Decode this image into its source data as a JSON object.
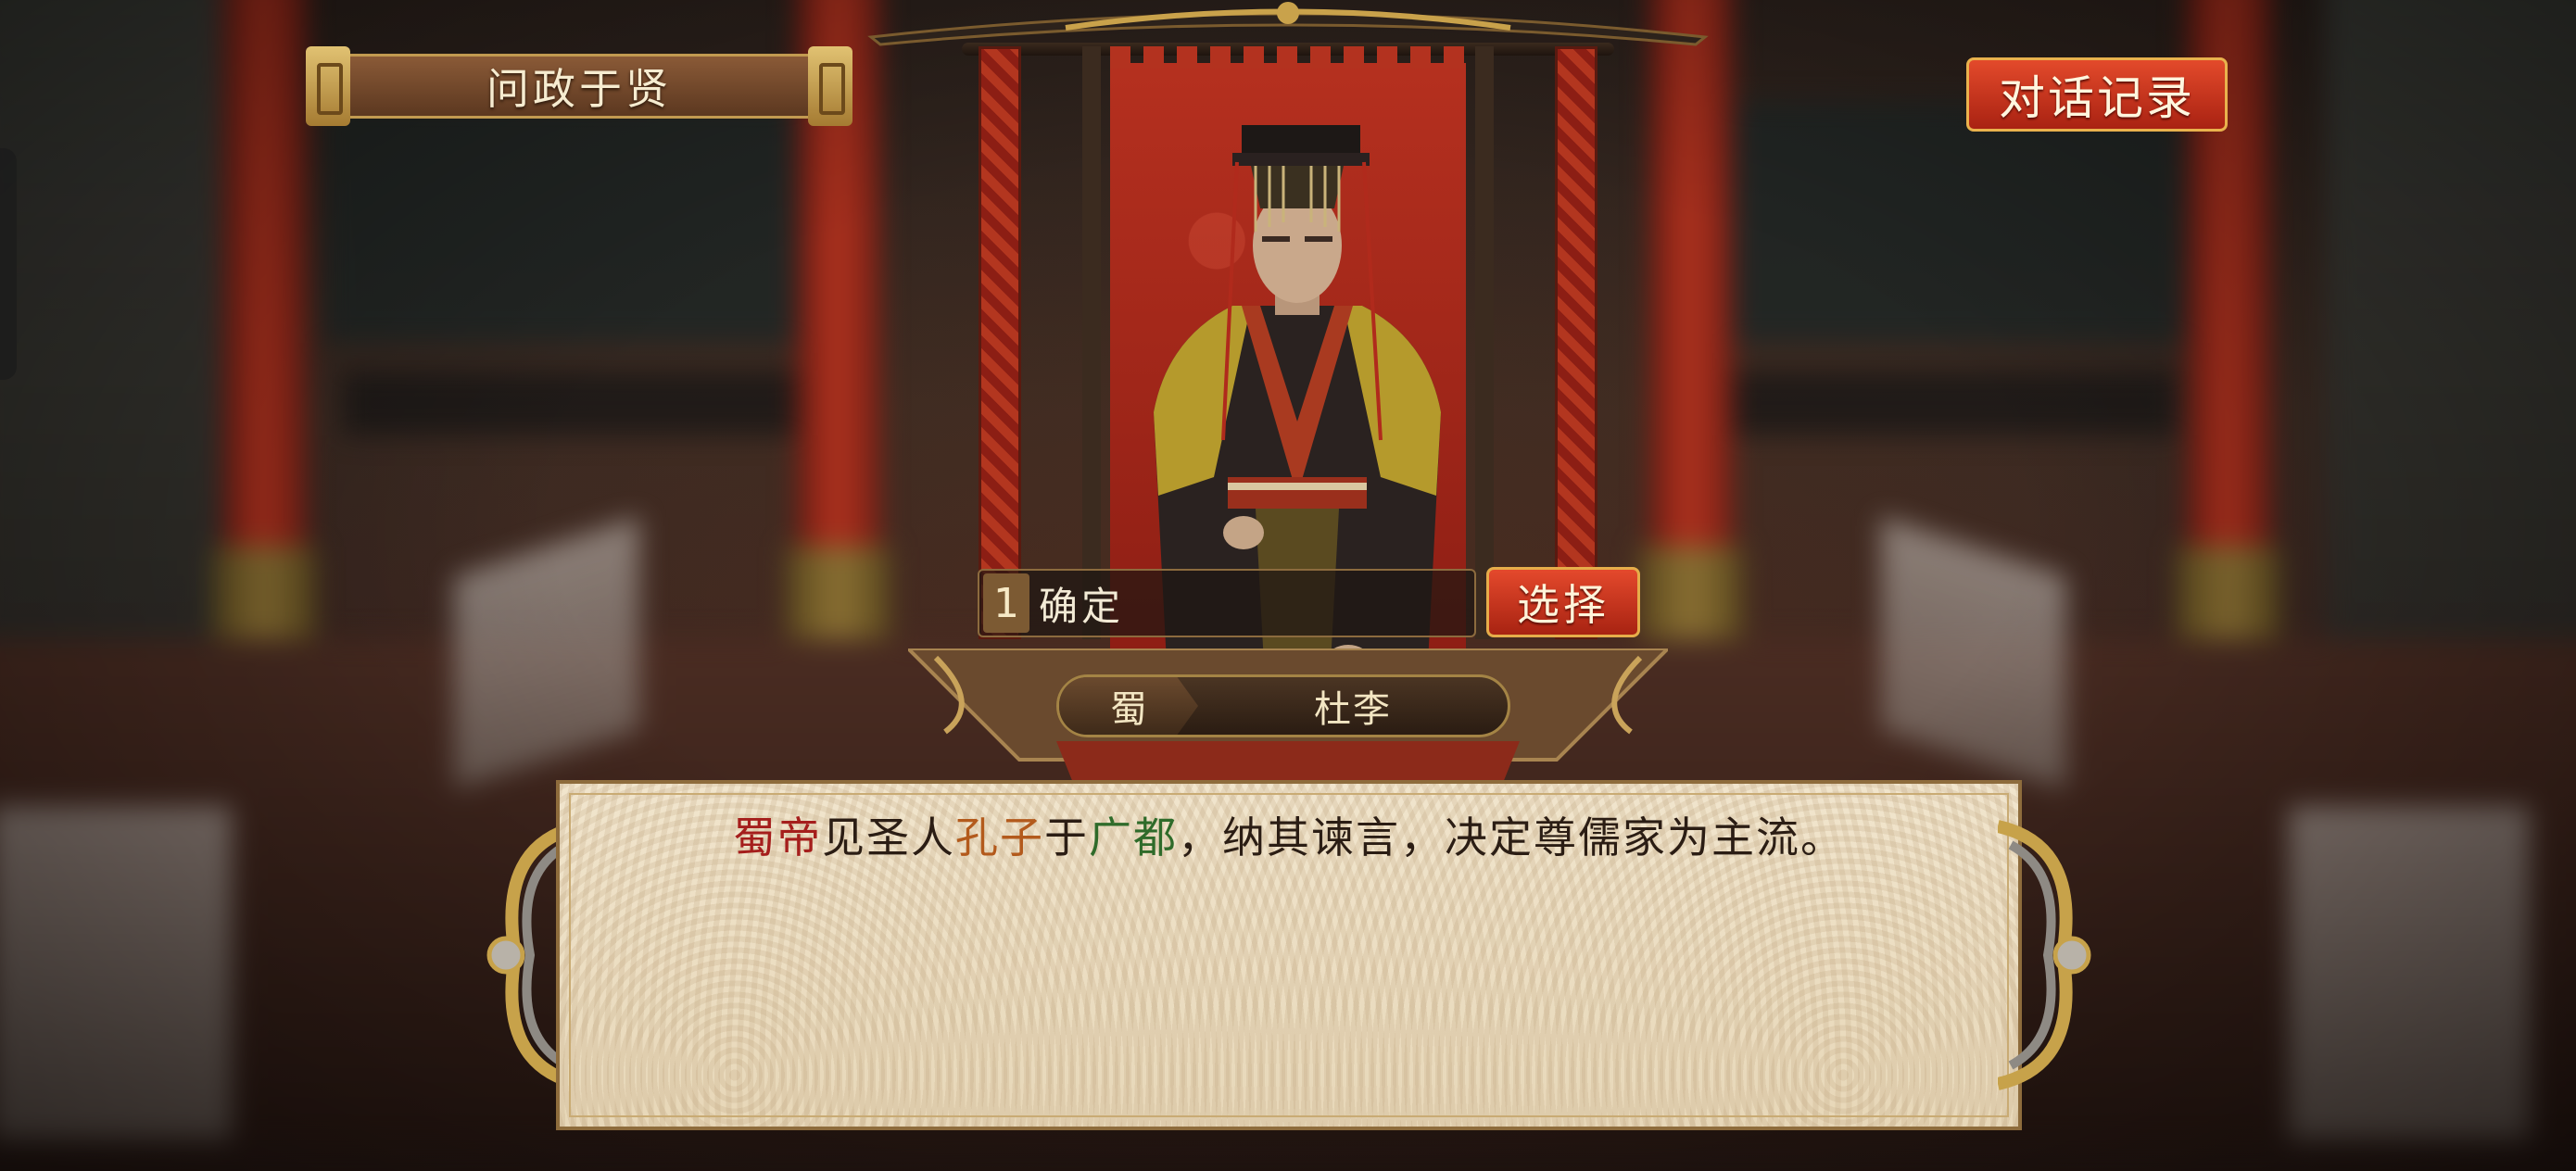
{
  "header": {
    "title": "问政于贤",
    "log_button_label": "对话记录"
  },
  "character": {
    "kingdom": "蜀",
    "name": "杜李"
  },
  "choices": [
    {
      "index": "1",
      "label": "确定"
    }
  ],
  "select_button_label": "选择",
  "dialogue": {
    "segments": [
      {
        "text": "蜀帝",
        "style": "kingdom"
      },
      {
        "text": "见圣人",
        "style": "plain"
      },
      {
        "text": "孔子",
        "style": "person"
      },
      {
        "text": "于",
        "style": "plain"
      },
      {
        "text": "广都",
        "style": "place"
      },
      {
        "text": "，纳其谏言，决定尊儒家为主流。",
        "style": "plain"
      }
    ]
  },
  "colors": {
    "kingdom_highlight": "#a51e1c",
    "person_highlight": "#b35a1c",
    "place_highlight": "#2f6b2a",
    "button_red": "#c8321c",
    "gold_trim": "#e6ad4a"
  }
}
